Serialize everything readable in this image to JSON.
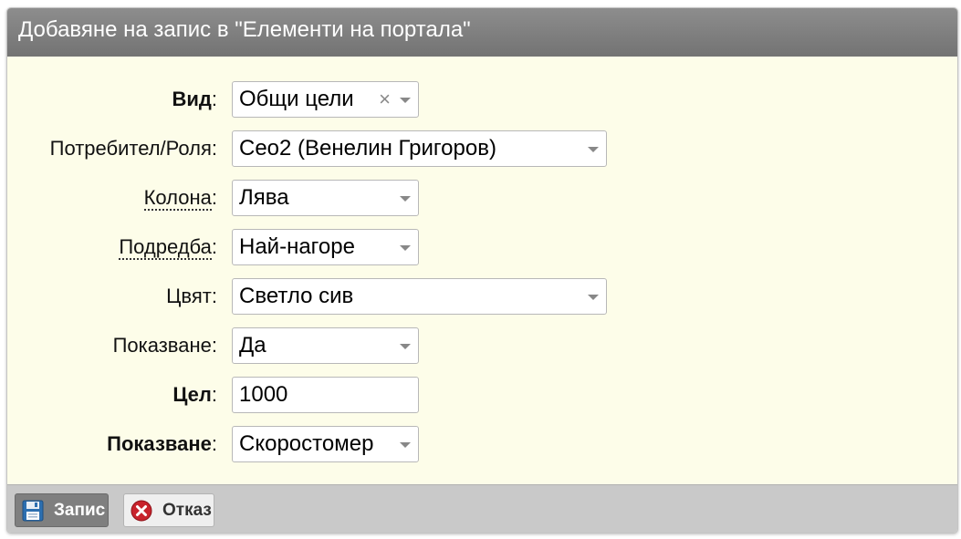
{
  "dialog": {
    "title": "Добавяне на запис в \"Елементи на портала\""
  },
  "form": {
    "fields": [
      {
        "label": "Вид",
        "value": "Общи цели",
        "clearable": true
      },
      {
        "label": "Потребител/Роля",
        "value": "Ceo2 (Венелин Григоров)"
      },
      {
        "label": "Колона",
        "value": "Лява"
      },
      {
        "label": "Подредба",
        "value": "Най-нагоре"
      },
      {
        "label": "Цвят",
        "value": "Светло сив"
      },
      {
        "label": "Показване",
        "value": "Да"
      },
      {
        "label": "Цел",
        "value": "1000"
      },
      {
        "label": "Показване",
        "value": "Скоростомер"
      }
    ],
    "colon": ":",
    "clear_glyph": "×"
  },
  "toolbar": {
    "save_label": "Запис",
    "cancel_label": "Отказ",
    "save_icon": "floppy-disk-icon",
    "cancel_icon": "cancel-x-icon"
  }
}
